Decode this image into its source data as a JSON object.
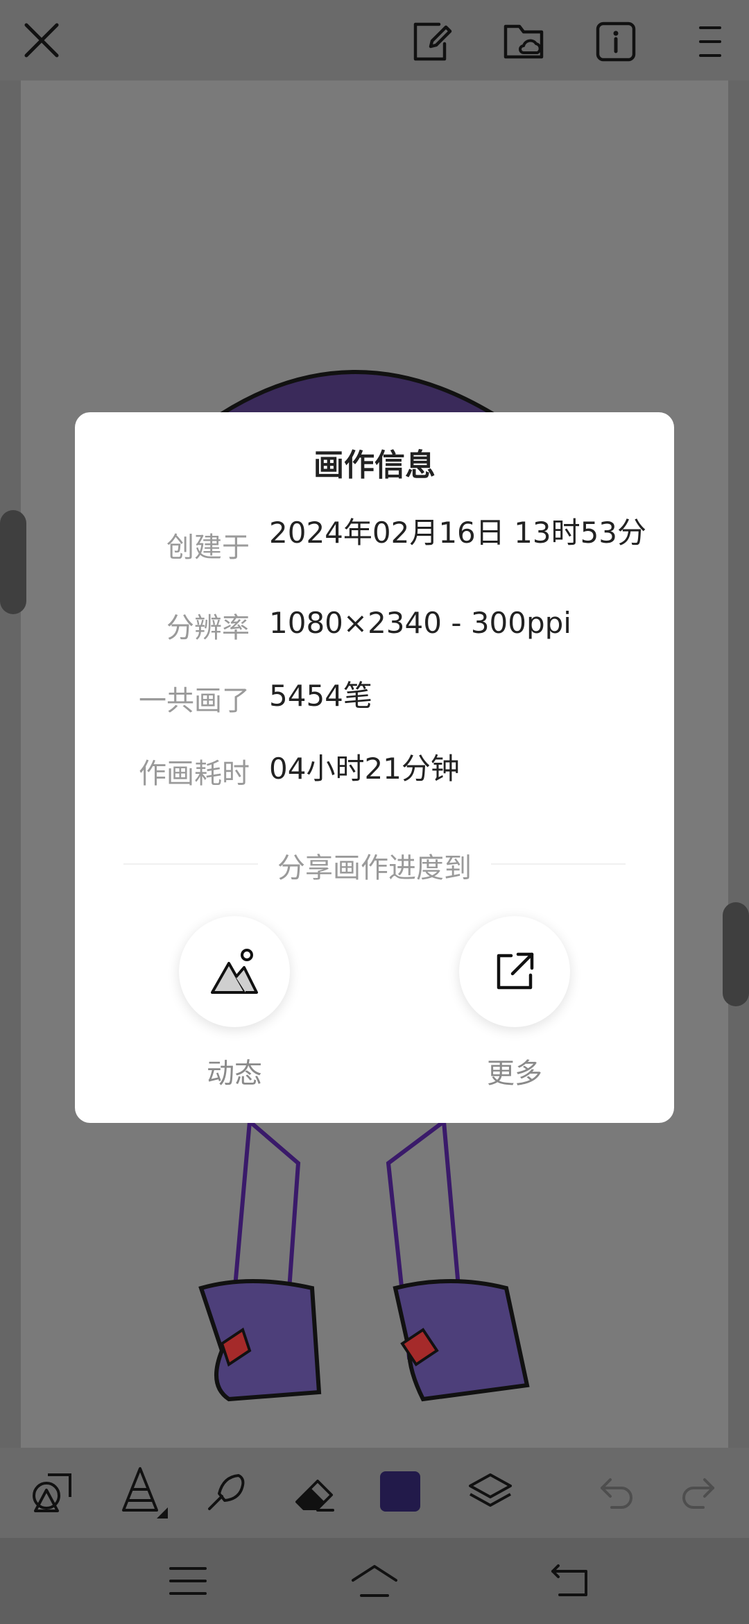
{
  "colors": {
    "current_color": "#221a4a"
  },
  "dialog": {
    "title": "画作信息",
    "rows": [
      {
        "label": "创建于",
        "value": "2024年02月16日 13时53分"
      },
      {
        "label": "分辨率",
        "value": "1080×2340 - 300ppi"
      },
      {
        "label": "一共画了",
        "value": "5454笔"
      },
      {
        "label": "作画耗时",
        "value": "04小时21分钟"
      }
    ],
    "share_title": "分享画作进度到",
    "share_options": [
      {
        "label": "动态",
        "icon": "mountain-icon"
      },
      {
        "label": "更多",
        "icon": "external-link-icon"
      }
    ]
  },
  "top_bar": {
    "icons": [
      "close-icon",
      "edit-note-icon",
      "cloud-folder-icon",
      "info-icon",
      "menu-icon"
    ]
  },
  "toolbar": {
    "tools": [
      "shapes-icon",
      "fill-cone-icon",
      "smudge-brush-icon",
      "eraser-icon",
      "color-swatch",
      "layers-icon",
      "undo-icon",
      "redo-icon"
    ]
  },
  "nav_bar": {
    "icons": [
      "recent-apps-icon",
      "home-icon",
      "back-icon"
    ]
  }
}
